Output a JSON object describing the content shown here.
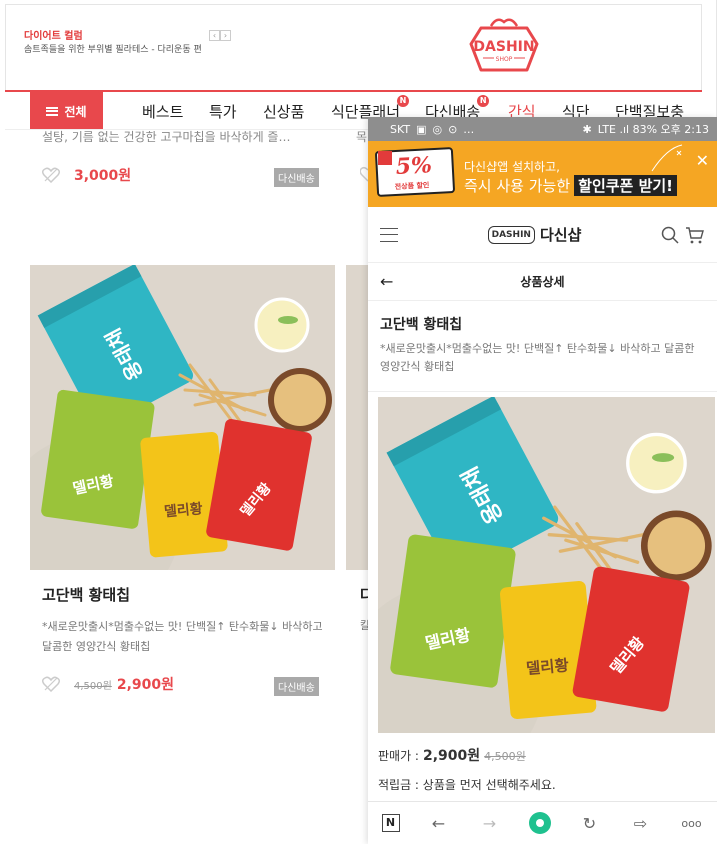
{
  "promo": {
    "title": "다이어트 컬럼",
    "subtitle": "솜트족들을 위한 부위별 필라테스 - 다리운동 편",
    "prev": "‹",
    "next": "›"
  },
  "logo": {
    "text": "DASHIN",
    "sub": "SHOP"
  },
  "nav": {
    "all": "전체",
    "items": [
      {
        "label": "베스트"
      },
      {
        "label": "특가"
      },
      {
        "label": "신상품"
      },
      {
        "label": "식단플래너",
        "badge": "N"
      },
      {
        "label": "다신배송",
        "badge": "N"
      },
      {
        "label": "간식"
      },
      {
        "label": "식단"
      },
      {
        "label": "단백질보충"
      }
    ]
  },
  "prev_card": {
    "desc": "설탕, 기름 없는 건강한 고구마칩을 바삭하게 즐…",
    "desc_right": "목",
    "price": "3,000원",
    "tag": "다신배송"
  },
  "product_card": {
    "name": "고단백 황태칩",
    "desc": "*새로운맛출시*멈출수없는 맛! 단백질↑ 탄수화물↓ 바삭하고 달콤한 영양간식 황태칩",
    "old_price": "4,500원",
    "price": "2,900원",
    "tag": "다신배송",
    "right_name": "다",
    "right_desc": "칼"
  },
  "mobile": {
    "status": {
      "carrier": "SKT",
      "right": "LTE .ıl 83% 오후 2:13"
    },
    "banner": {
      "coupon_pct": "5%",
      "coupon_text": "전상품 할인",
      "line1": "다신샵앱 설치하고,",
      "line2": "즉시 사용 가능한",
      "highlight": "할인쿠폰 받기!",
      "close": "✕"
    },
    "header": {
      "badge": "DASHIN",
      "name": "다신샵"
    },
    "subheader": {
      "title": "상품상세",
      "back": "←"
    },
    "product": {
      "name": "고단백 황태칩",
      "desc": "*새로운맛출시*멈출수없는 맛! 단백질↑ 탄수화물↓ 바삭하고 달콤한 영양간식 황태칩",
      "price_label": "판매가 :",
      "price": "2,900원",
      "old_price": "4,500원",
      "point": "적립금 : 상품을 먼저 선택해주세요."
    },
    "toolbar": {
      "n": "N",
      "back": "←",
      "forward": "→",
      "reload": "↻",
      "share": "⇨",
      "more": "ooo"
    }
  },
  "package_labels": {
    "green": "용태채",
    "delicious": "델리황"
  },
  "colors": {
    "brand": "#e8484c",
    "banner": "#f5a623",
    "teal": "#2fb6c4",
    "lime": "#9ac33a",
    "yellow": "#f3c419",
    "red": "#e0322e"
  }
}
